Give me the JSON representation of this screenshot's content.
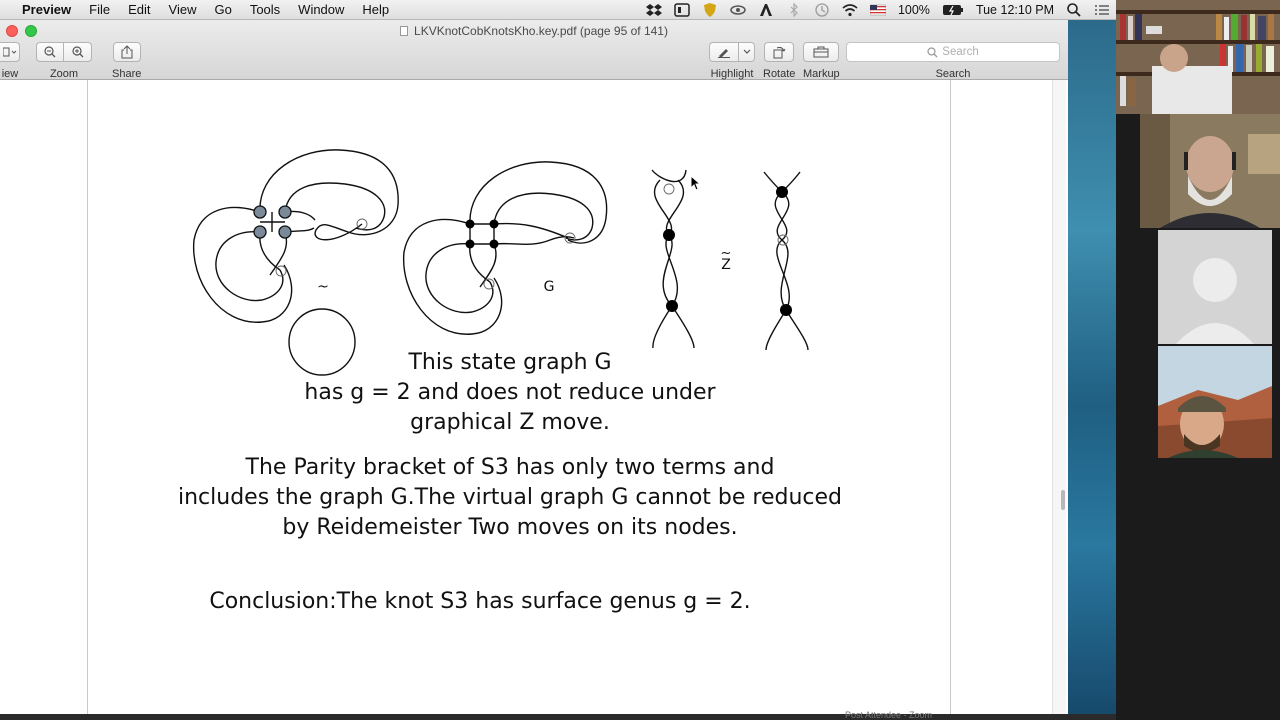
{
  "menubar": {
    "app": "Preview",
    "items": [
      "File",
      "Edit",
      "View",
      "Go",
      "Tools",
      "Window",
      "Help"
    ],
    "battery": "100%",
    "clock": "Tue 12:10 PM"
  },
  "window": {
    "title": "LKVKnotCobKnotsKho.key.pdf (page 95 of 141)",
    "toolbar": {
      "view_label": "iew",
      "zoom_label": "Zoom",
      "share_label": "Share",
      "highlight_label": "Highlight",
      "rotate_label": "Rotate",
      "markup_label": "Markup",
      "search_label": "Search",
      "search_placeholder": "Search"
    }
  },
  "slide": {
    "label_tilde": "~",
    "label_G": "G",
    "label_Z": "Z",
    "label_Z_tilde": "~",
    "para1": [
      "This state graph G",
      "has g = 2 and does not reduce under",
      "graphical Z move."
    ],
    "para2": [
      "The Parity bracket of S3 has only two terms and",
      "includes the graph G.The virtual graph G cannot be reduced",
      "by Reidemeister Two moves on its nodes."
    ],
    "conclusion": "Conclusion:The knot S3 has surface genus g = 2."
  },
  "dock_hint": "Post Attendee - Zoom",
  "colors": {
    "node_fill": "#7a8a99",
    "black_node": "#000000",
    "accent_green": "#34c84a",
    "close_red": "#fc605c"
  }
}
